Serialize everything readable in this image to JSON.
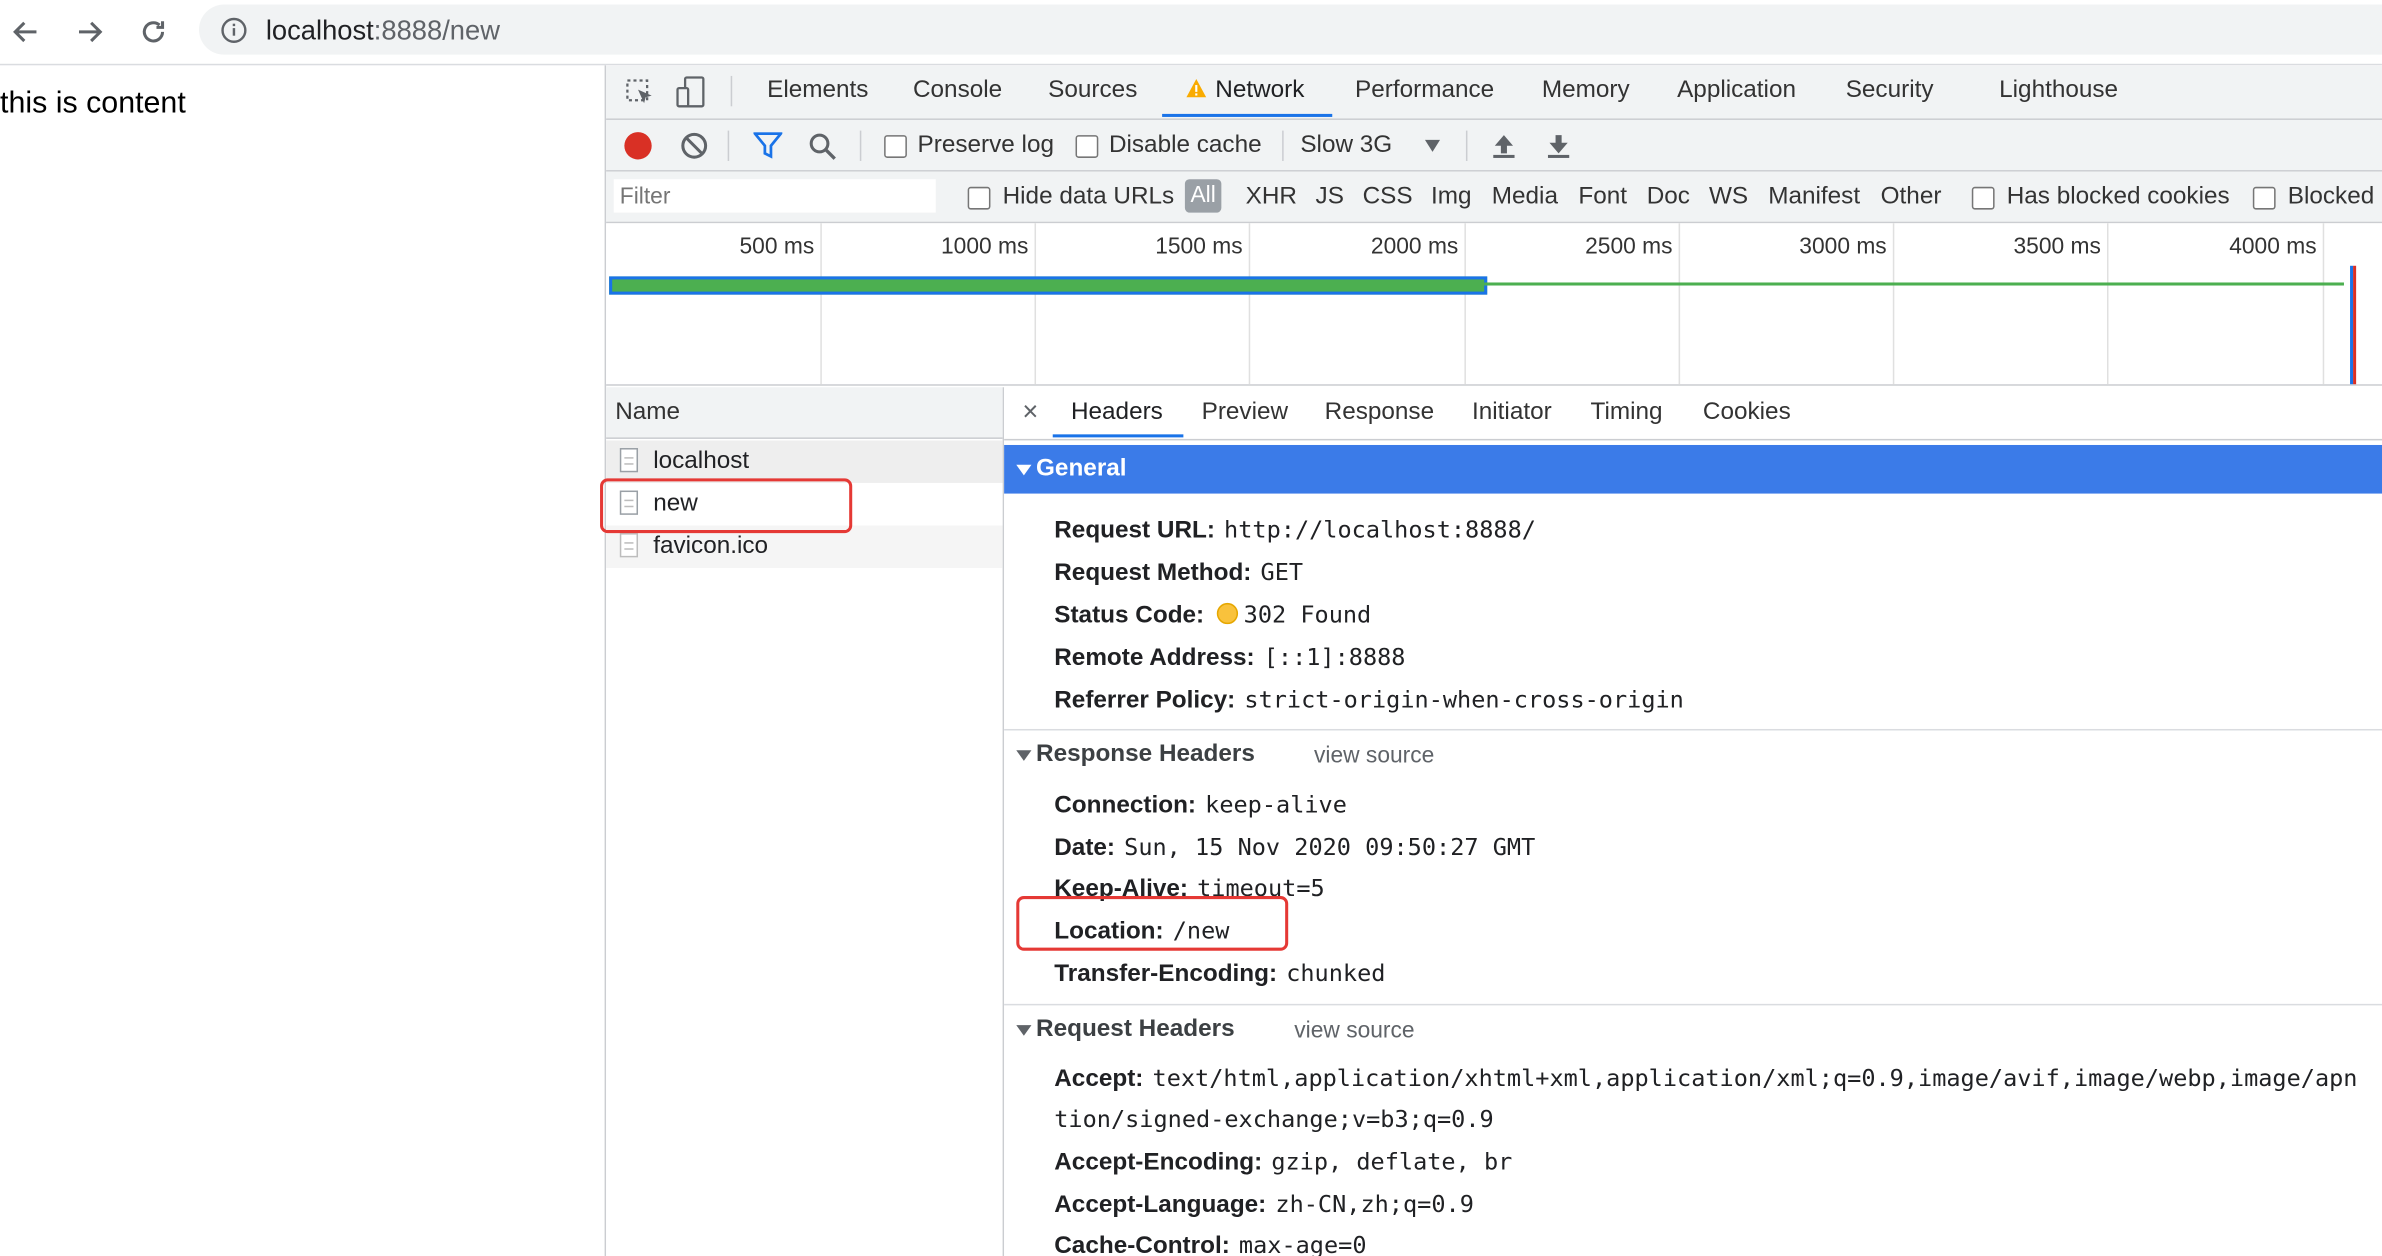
{
  "browser": {
    "url_host": "localhost",
    "url_path": ":8888/new"
  },
  "page": {
    "content_text": "this is content"
  },
  "devtools": {
    "tabs": [
      "Elements",
      "Console",
      "Sources",
      "Network",
      "Performance",
      "Memory",
      "Application",
      "Security",
      "Lighthouse"
    ],
    "active_tab": "Network",
    "toolbar": {
      "preserve_log": "Preserve log",
      "disable_cache": "Disable cache",
      "throttling": "Slow 3G"
    },
    "filter": {
      "placeholder": "Filter",
      "hide_data_urls": "Hide data URLs",
      "all": "All",
      "types": [
        "XHR",
        "JS",
        "CSS",
        "Img",
        "Media",
        "Font",
        "Doc",
        "WS",
        "Manifest",
        "Other"
      ],
      "has_blocked_cookies": "Has blocked cookies",
      "blocked": "Blocked"
    },
    "overview": {
      "ticks": [
        "500 ms",
        "1000 ms",
        "1500 ms",
        "2000 ms",
        "2500 ms",
        "3000 ms",
        "3500 ms",
        "4000 ms"
      ]
    },
    "requests": {
      "header": "Name",
      "items": [
        "localhost",
        "new",
        "favicon.ico"
      ]
    },
    "detail": {
      "close": "×",
      "tabs": [
        "Headers",
        "Preview",
        "Response",
        "Initiator",
        "Timing",
        "Cookies"
      ],
      "general": {
        "title": "General",
        "rows": [
          {
            "k": "Request URL:",
            "v": "http://localhost:8888/"
          },
          {
            "k": "Request Method:",
            "v": "GET"
          },
          {
            "k": "Status Code:",
            "v": "302 Found"
          },
          {
            "k": "Remote Address:",
            "v": "[::1]:8888"
          },
          {
            "k": "Referrer Policy:",
            "v": "strict-origin-when-cross-origin"
          }
        ]
      },
      "response_headers": {
        "title": "Response Headers",
        "view_source": "view source",
        "rows": [
          {
            "k": "Connection:",
            "v": "keep-alive"
          },
          {
            "k": "Date:",
            "v": "Sun, 15 Nov 2020 09:50:27 GMT"
          },
          {
            "k": "Keep-Alive:",
            "v": "timeout=5"
          },
          {
            "k": "Location:",
            "v": "/new"
          },
          {
            "k": "Transfer-Encoding:",
            "v": "chunked"
          }
        ]
      },
      "request_headers": {
        "title": "Request Headers",
        "view_source": "view source",
        "rows": [
          {
            "k": "Accept:",
            "v": "text/html,application/xhtml+xml,application/xml;q=0.9,image/avif,image/webp,image/apn"
          },
          {
            "k": "",
            "v": "tion/signed-exchange;v=b3;q=0.9"
          },
          {
            "k": "Accept-Encoding:",
            "v": "gzip, deflate, br"
          },
          {
            "k": "Accept-Language:",
            "v": "zh-CN,zh;q=0.9"
          },
          {
            "k": "Cache-Control:",
            "v": "max-age=0"
          }
        ]
      }
    }
  }
}
